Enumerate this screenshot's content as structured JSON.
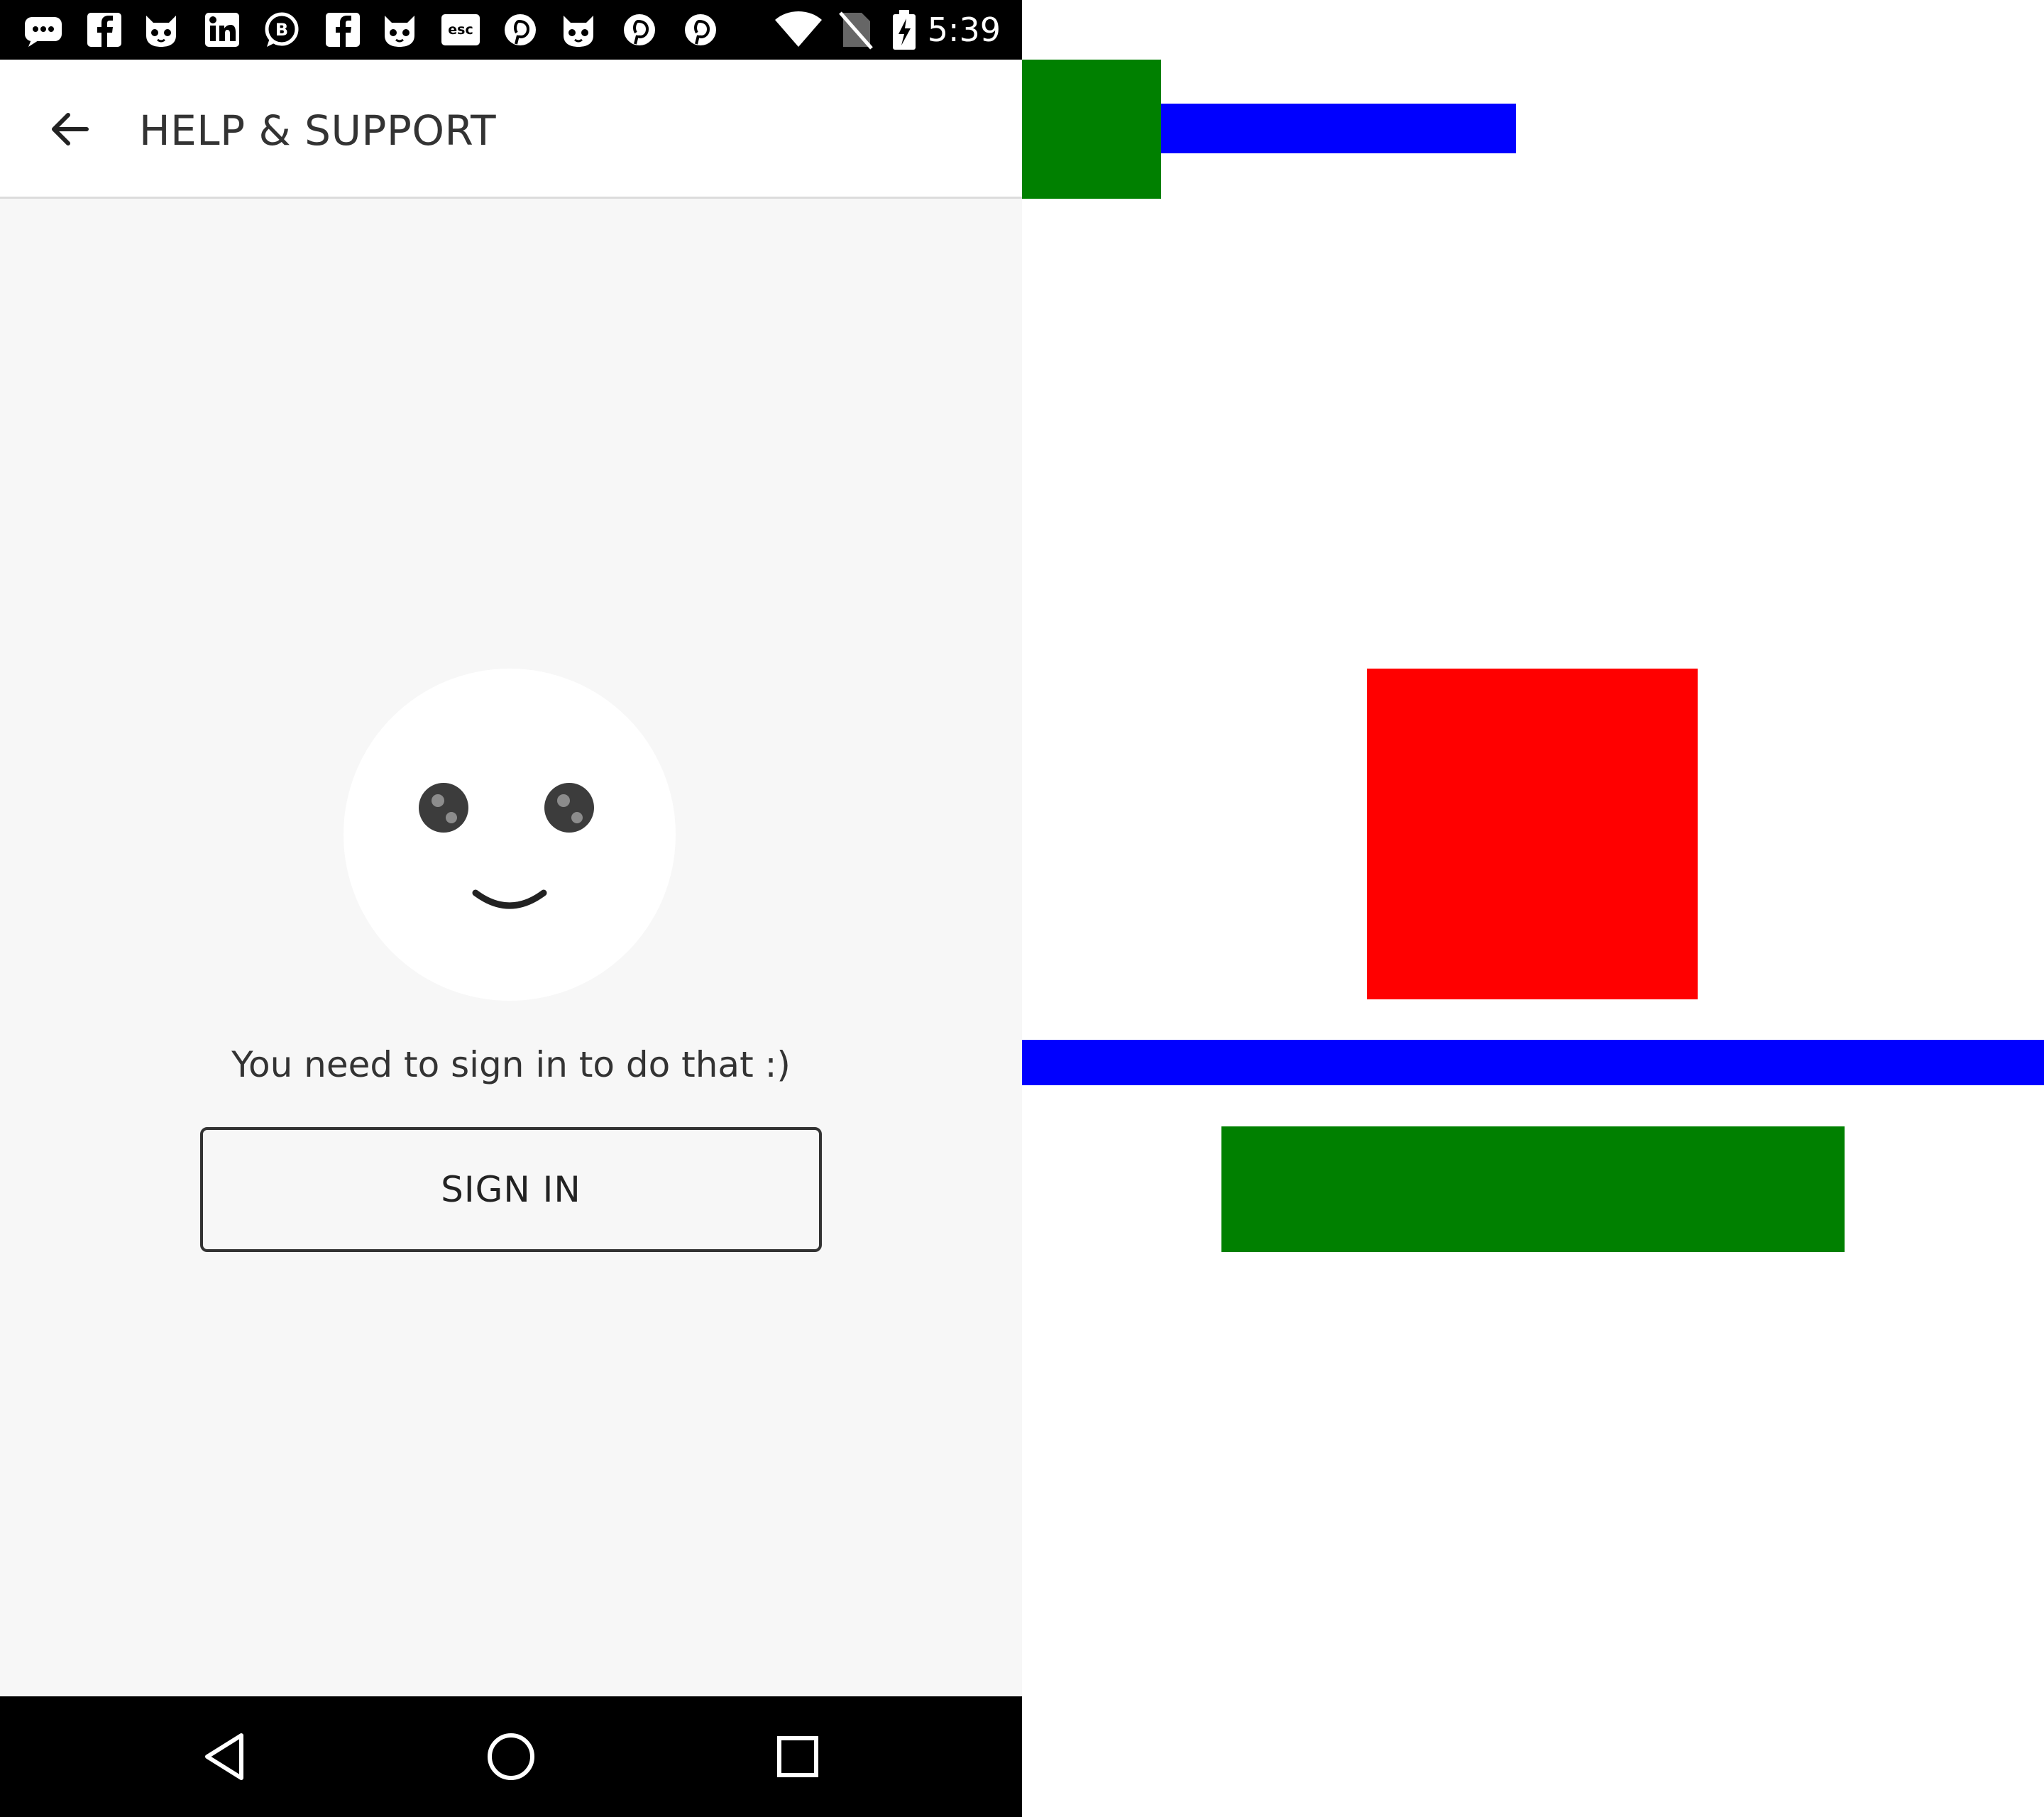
{
  "status_bar": {
    "time": "5:39",
    "notification_icons": [
      "chat-icon",
      "facebook-icon",
      "cat-icon",
      "linkedin-icon",
      "b-chat-icon",
      "facebook-icon",
      "cat-icon",
      "esc-icon",
      "pinterest-icon",
      "cat-icon",
      "pinterest-icon",
      "pinterest-icon"
    ],
    "system_icons": [
      "wifi-icon",
      "no-sim-icon",
      "battery-charging-icon"
    ]
  },
  "app_bar": {
    "title": "HELP & SUPPORT",
    "back_icon": "arrow-back-icon"
  },
  "content": {
    "illustration": "smiley-face-icon",
    "message": "You need to sign in to do that :)",
    "sign_in_label": "SIGN IN"
  },
  "nav_bar": {
    "buttons": [
      "back-triangle-icon",
      "home-circle-icon",
      "recents-square-icon"
    ]
  },
  "annotation_colors": {
    "green": "#008000",
    "blue": "#0000ff",
    "red": "#ff0000"
  }
}
